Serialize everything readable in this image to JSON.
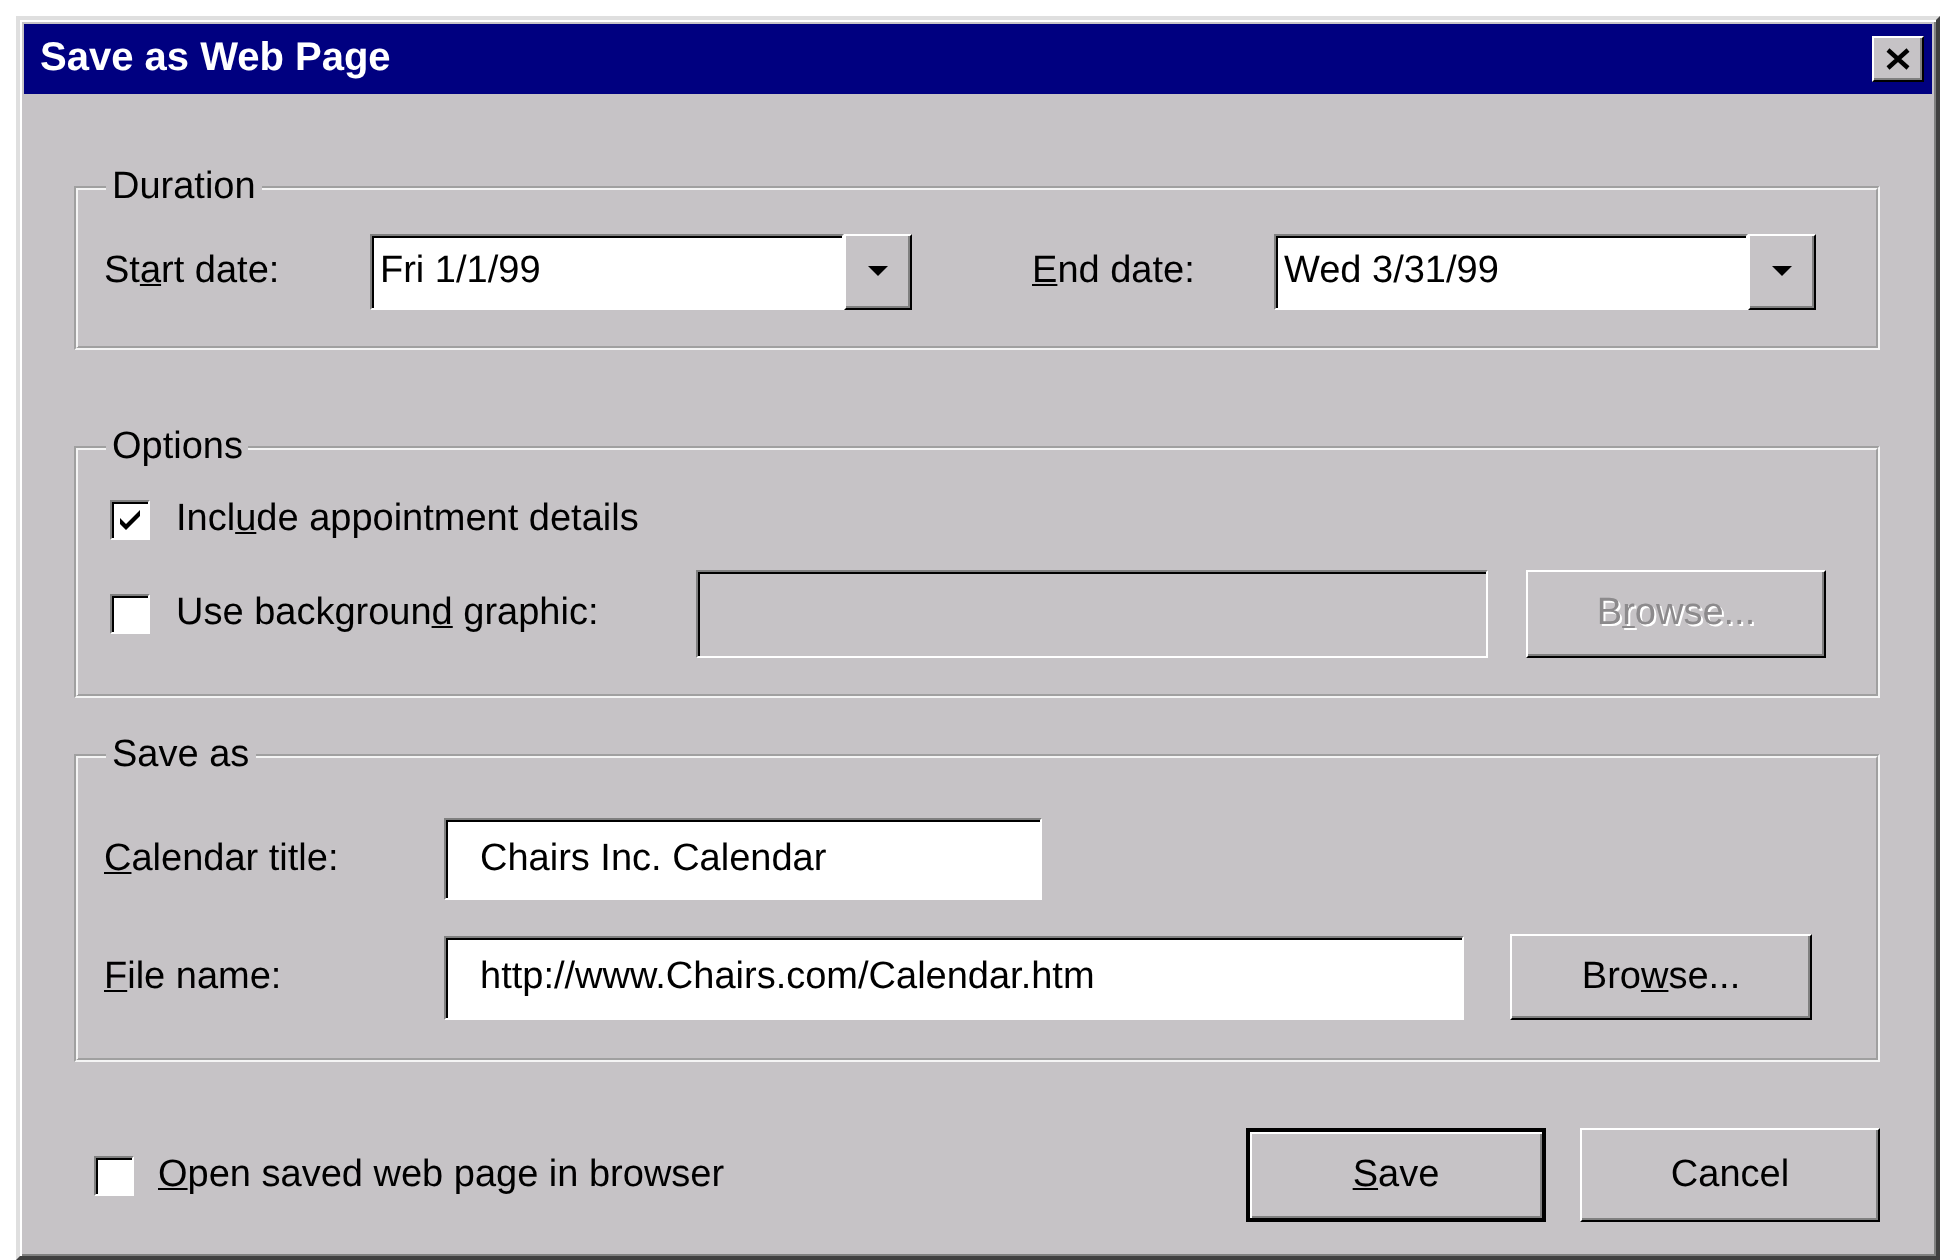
{
  "window": {
    "title": "Save as Web Page"
  },
  "duration": {
    "title": "Duration",
    "start_date": {
      "label": {
        "pre": "St",
        "key": "a",
        "post": "rt date:"
      },
      "value": "Fri 1/1/99"
    },
    "end_date": {
      "label": {
        "key": "E",
        "post": "nd date:"
      },
      "value": "Wed 3/31/99"
    }
  },
  "options": {
    "title": "Options",
    "include_details": {
      "label": {
        "pre": "Incl",
        "key": "u",
        "post": "de appointment details"
      },
      "checked": true
    },
    "background_graphic": {
      "label": {
        "pre": "Use backgroun",
        "key": "d",
        "post": " graphic:"
      },
      "checked": false,
      "browse_button": {
        "label": {
          "pre": "B",
          "key": "r",
          "post": "owse..."
        },
        "disabled": true
      }
    }
  },
  "save_as": {
    "title": "Save as",
    "calendar_title": {
      "label": {
        "key": "C",
        "post": "alendar title:"
      },
      "value": "Chairs Inc. Calendar"
    },
    "file_name": {
      "label": {
        "key": "F",
        "post": "ile name:"
      },
      "value": "http://www.Chairs.com/Calendar.htm",
      "browse_button": {
        "label": {
          "pre": "Bro",
          "key": "w",
          "post": "se..."
        },
        "disabled": false
      }
    }
  },
  "open_in_browser": {
    "label": {
      "key": "O",
      "post": "pen saved web page in browser"
    },
    "checked": false
  },
  "buttons": [
    {
      "label": {
        "key": "S",
        "post": "ave"
      },
      "default": true
    },
    {
      "label": "Cancel",
      "default": false
    }
  ]
}
